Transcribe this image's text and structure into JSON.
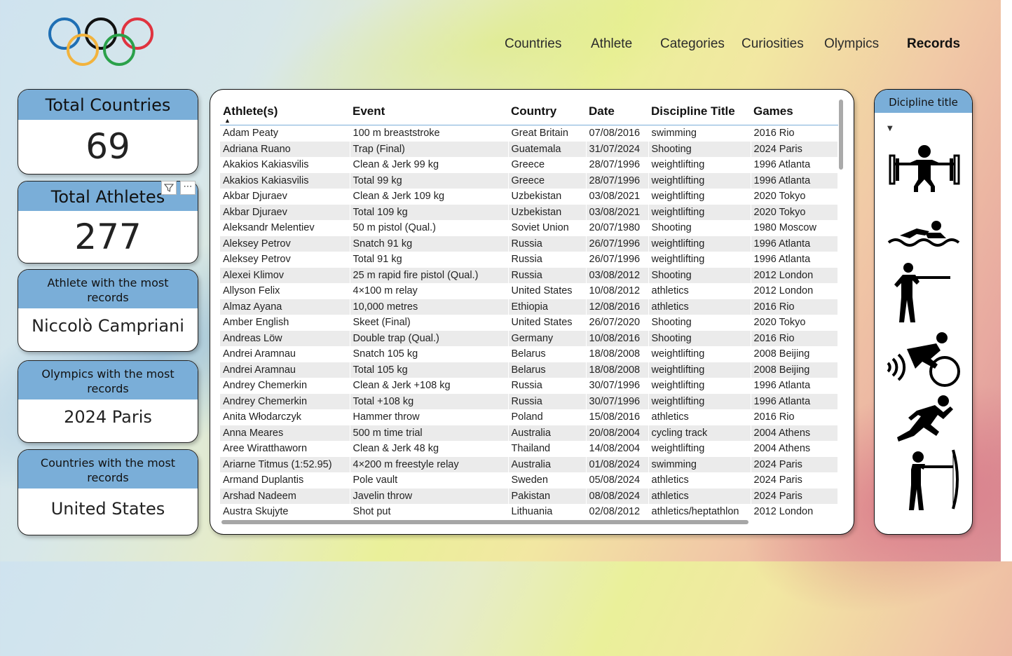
{
  "nav": [
    "Countries",
    "Athlete",
    "Categories",
    "Curiosities",
    "Olympics",
    "Records"
  ],
  "cards": {
    "total_countries": {
      "label": "Total Countries",
      "value": "69"
    },
    "total_athletes": {
      "label": "Total Athletes",
      "value": "277"
    },
    "athlete_most": {
      "label_line1": "Athlete with the most",
      "label_line2": "records",
      "value": "Niccolò Campriani"
    },
    "olympics_most": {
      "label_line1": "Olympics with the most",
      "label_line2": "records",
      "value": "2024 Paris"
    },
    "countries_most": {
      "label_line1": "Countries with the most",
      "label_line2": "records",
      "value": "United States"
    }
  },
  "card_tools": {
    "filter": "filter-icon",
    "more": "⋯"
  },
  "table": {
    "columns": [
      "Athlete(s)",
      "Event",
      "Country",
      "Date",
      "Discipline Title",
      "Games"
    ],
    "rows": [
      [
        "Adam Peaty",
        "100 m breaststroke",
        "Great Britain",
        "07/08/2016",
        "swimming",
        "2016 Rio"
      ],
      [
        "Adriana Ruano",
        "Trap (Final)",
        "Guatemala",
        "31/07/2024",
        "Shooting",
        "2024 Paris"
      ],
      [
        "Akakios Kakiasvilis",
        "Clean & Jerk 99 kg",
        "Greece",
        "28/07/1996",
        "weightlifting",
        "1996 Atlanta"
      ],
      [
        "Akakios Kakiasvilis",
        "Total 99 kg",
        "Greece",
        "28/07/1996",
        "weightlifting",
        "1996 Atlanta"
      ],
      [
        "Akbar Djuraev",
        "Clean & Jerk 109 kg",
        "Uzbekistan",
        "03/08/2021",
        "weightlifting",
        "2020 Tokyo"
      ],
      [
        "Akbar Djuraev",
        "Total 109 kg",
        "Uzbekistan",
        "03/08/2021",
        "weightlifting",
        "2020 Tokyo"
      ],
      [
        "Aleksandr Melentiev",
        "50 m pistol (Qual.)",
        "Soviet Union",
        "20/07/1980",
        "Shooting",
        "1980 Moscow"
      ],
      [
        "Aleksey Petrov",
        "Snatch 91 kg",
        "Russia",
        "26/07/1996",
        "weightlifting",
        "1996 Atlanta"
      ],
      [
        "Aleksey Petrov",
        "Total 91 kg",
        "Russia",
        "26/07/1996",
        "weightlifting",
        "1996 Atlanta"
      ],
      [
        "Alexei Klimov",
        "25 m rapid fire pistol (Qual.)",
        "Russia",
        "03/08/2012",
        "Shooting",
        "2012 London"
      ],
      [
        "Allyson Felix",
        "4×100 m relay",
        "United States",
        "10/08/2012",
        "athletics",
        "2012 London"
      ],
      [
        "Almaz Ayana",
        "10,000 metres",
        "Ethiopia",
        "12/08/2016",
        "athletics",
        "2016 Rio"
      ],
      [
        "Amber English",
        "Skeet (Final)",
        "United States",
        "26/07/2020",
        "Shooting",
        "2020 Tokyo"
      ],
      [
        "Andreas Löw",
        "Double trap (Qual.)",
        "Germany",
        "10/08/2016",
        "Shooting",
        "2016 Rio"
      ],
      [
        "Andrei Aramnau",
        "Snatch 105 kg",
        "Belarus",
        "18/08/2008",
        "weightlifting",
        "2008 Beijing"
      ],
      [
        "Andrei Aramnau",
        "Total 105 kg",
        "Belarus",
        "18/08/2008",
        "weightlifting",
        "2008 Beijing"
      ],
      [
        "Andrey Chemerkin",
        "Clean & Jerk +108 kg",
        "Russia",
        "30/07/1996",
        "weightlifting",
        "1996 Atlanta"
      ],
      [
        "Andrey Chemerkin",
        "Total +108 kg",
        "Russia",
        "30/07/1996",
        "weightlifting",
        "1996 Atlanta"
      ],
      [
        "Anita Włodarczyk",
        "Hammer throw",
        "Poland",
        "15/08/2016",
        "athletics",
        "2016 Rio"
      ],
      [
        "Anna Meares",
        "500 m time trial",
        "Australia",
        "20/08/2004",
        "cycling track",
        "2004 Athens"
      ],
      [
        "Aree Wiratthaworn",
        "Clean & Jerk 48 kg",
        "Thailand",
        "14/08/2004",
        "weightlifting",
        "2004 Athens"
      ],
      [
        "Ariarne Titmus (1:52.95)",
        "4×200 m freestyle relay",
        "Australia",
        "01/08/2024",
        "swimming",
        "2024 Paris"
      ],
      [
        "Armand Duplantis",
        "Pole vault",
        "Sweden",
        "05/08/2024",
        "athletics",
        "2024 Paris"
      ],
      [
        "Arshad Nadeem",
        "Javelin throw",
        "Pakistan",
        "08/08/2024",
        "athletics",
        "2024 Paris"
      ],
      [
        "Austra Skujyte",
        "Shot put",
        "Lithuania",
        "02/08/2012",
        "athletics/heptathlon",
        "2012 London"
      ]
    ]
  },
  "slicer": {
    "title": "Dicipline title",
    "icons": [
      "weightlifting-icon",
      "swimming-icon",
      "shooting-icon",
      "cycling-icon",
      "athletics-icon",
      "archery-icon"
    ]
  },
  "colors": {
    "header_blue": "#7aaed8",
    "ring_blue": "#1f6fb4",
    "ring_yellow": "#f2b33d",
    "ring_black": "#111111",
    "ring_green": "#2aa14a",
    "ring_red": "#e0333f"
  }
}
